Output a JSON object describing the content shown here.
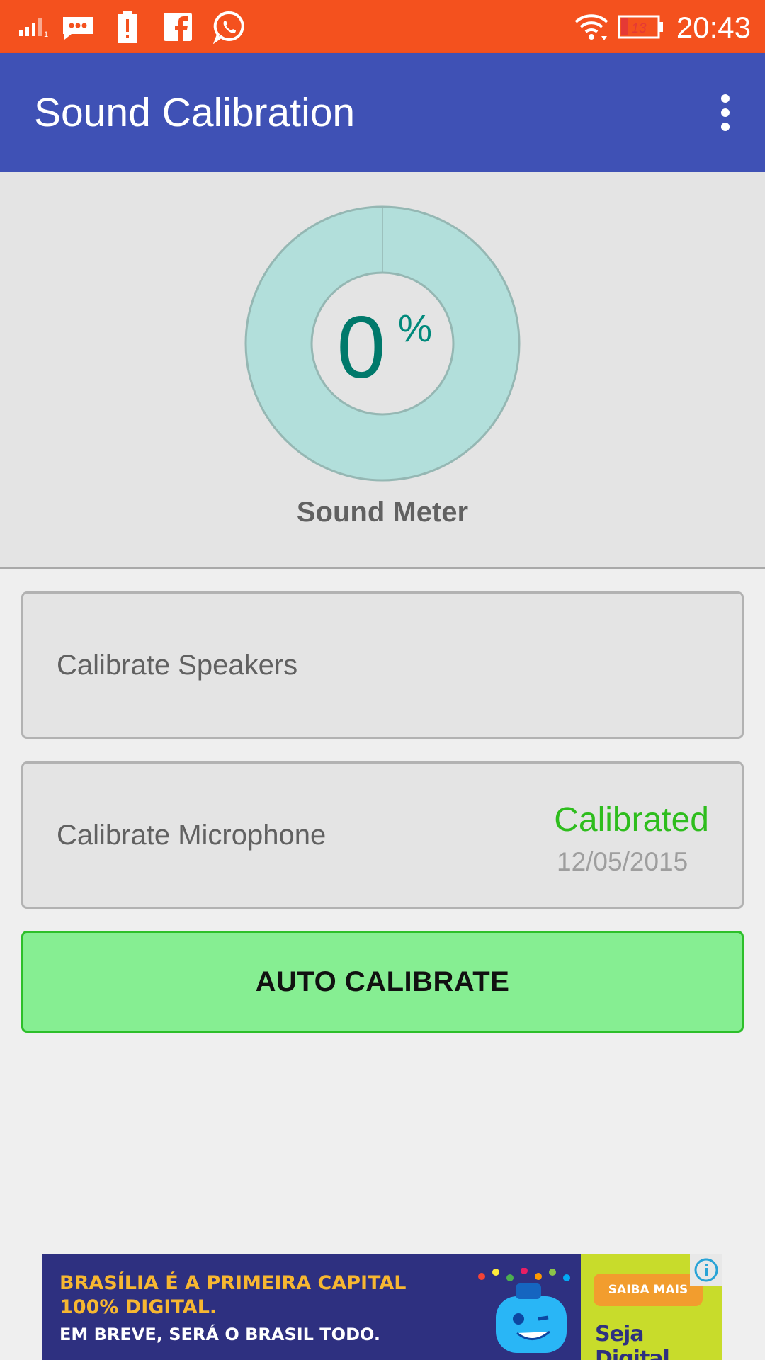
{
  "status_bar": {
    "time": "20:43",
    "battery_level": "13",
    "icons": [
      "signal-icon",
      "message-icon",
      "battery-alert-icon",
      "facebook-icon",
      "whatsapp-icon",
      "wifi-icon",
      "battery-icon"
    ],
    "background": "#f4511e"
  },
  "app_bar": {
    "title": "Sound Calibration",
    "menu_icon": "more-vert-icon",
    "background": "#3f51b5"
  },
  "meter": {
    "value": "0",
    "unit": "%",
    "label": "Sound Meter",
    "level_fraction": 0,
    "ring_color": "#b2dfdb",
    "value_color": "#00796b"
  },
  "cards": {
    "speakers": {
      "label": "Calibrate Speakers"
    },
    "microphone": {
      "label": "Calibrate Microphone",
      "status": "Calibrated",
      "date": "12/05/2015",
      "status_color": "#2ebd1d"
    }
  },
  "auto_calibrate": {
    "label": "AUTO CALIBRATE",
    "background": "#86ee92"
  },
  "ad": {
    "line1": "BRASÍLIA É A PRIMEIRA CAPITAL",
    "line2": "100% DIGITAL.",
    "line3": "EM BREVE, SERÁ O BRASIL TODO.",
    "cta": "SAIBA MAIS",
    "brand": "Seja Digital",
    "info_icon": "info-icon"
  }
}
